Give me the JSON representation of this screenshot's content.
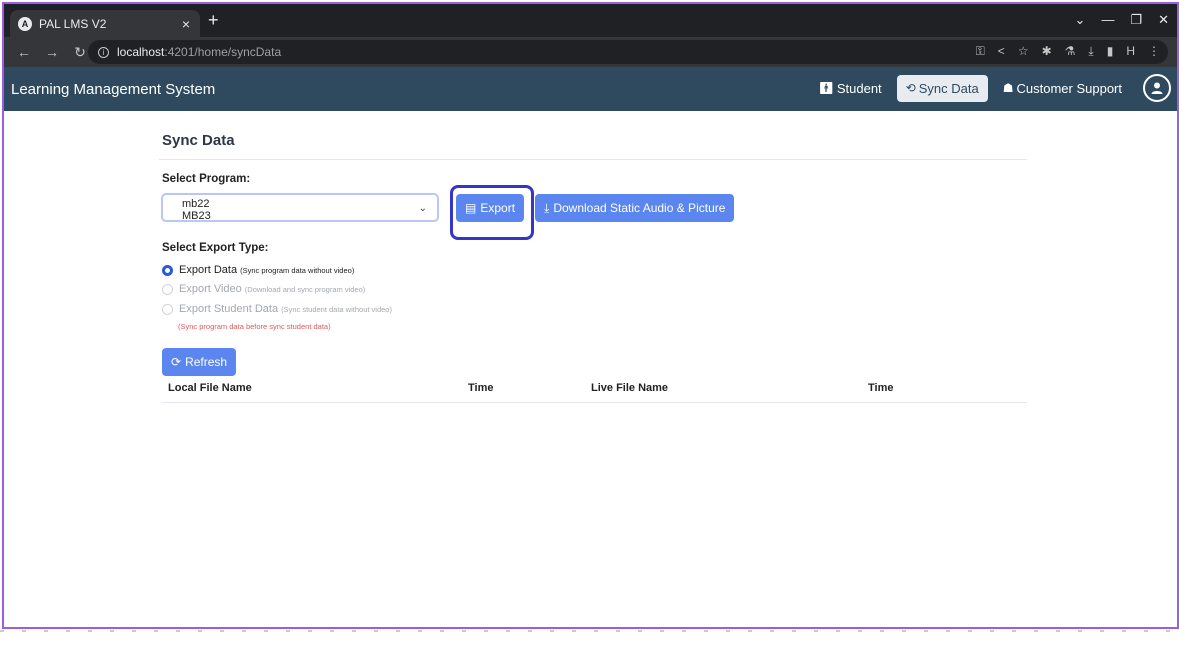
{
  "browser": {
    "tab_title": "PAL LMS V2",
    "tab_favicon": "A",
    "tab_close": "×",
    "new_tab": "+",
    "url_host": "localhost",
    "url_path": ":4201/home/syncData",
    "window_controls": [
      "⌄",
      "—",
      "❐",
      "✕"
    ]
  },
  "app": {
    "title": "Learning Management System",
    "nav": {
      "student": "Student",
      "sync_data": "Sync Data",
      "customer_support": "Customer Support"
    }
  },
  "page": {
    "title": "Sync Data",
    "select_program_label": "Select Program:",
    "program_options": [
      "mb22",
      "MB23"
    ],
    "export_button": "Export",
    "download_button": "Download Static Audio & Picture",
    "export_type_label": "Select Export Type:",
    "export_types": [
      {
        "label": "Export Data",
        "hint": "(Sync program data without video)",
        "checked": true,
        "disabled": false
      },
      {
        "label": "Export Video",
        "hint": "(Download and sync program video)",
        "checked": false,
        "disabled": true
      },
      {
        "label": "Export Student Data",
        "hint": "(Sync student data without video)",
        "checked": false,
        "disabled": true
      }
    ],
    "warning": "(Sync program data before sync student data)",
    "refresh_button": "Refresh",
    "table_headers": [
      "Local File Name",
      "Time",
      "Live File Name",
      "Time"
    ]
  },
  "colors": {
    "accent": "#5b86f0",
    "header": "#2f4a5f",
    "highlight": "#3535c9",
    "warning": "#e05a5a"
  }
}
